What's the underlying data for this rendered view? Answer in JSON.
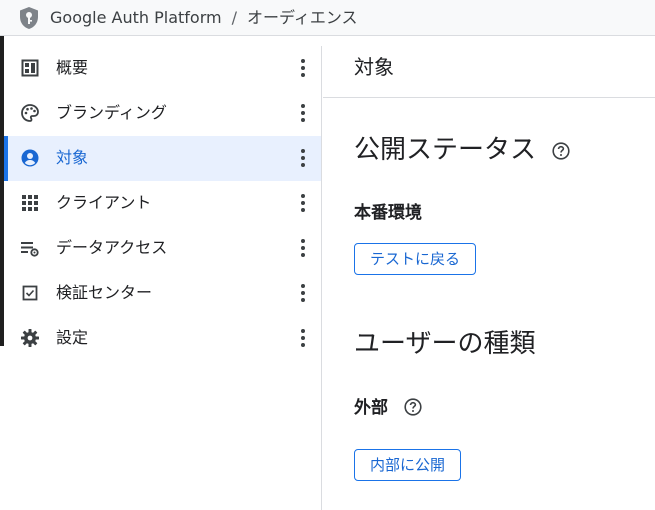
{
  "header": {
    "app_title": "Google Auth Platform",
    "separator": "/",
    "current_page": "オーディエンス"
  },
  "sidebar": {
    "items": [
      {
        "label": "概要",
        "icon": "dashboard-icon",
        "active": false
      },
      {
        "label": "ブランディング",
        "icon": "palette-icon",
        "active": false
      },
      {
        "label": "対象",
        "icon": "account-circle-icon",
        "active": true
      },
      {
        "label": "クライアント",
        "icon": "apps-grid-icon",
        "active": false
      },
      {
        "label": "データアクセス",
        "icon": "data-settings-icon",
        "active": false
      },
      {
        "label": "検証センター",
        "icon": "checkbox-icon",
        "active": false
      },
      {
        "label": "設定",
        "icon": "gear-icon",
        "active": false
      }
    ]
  },
  "main": {
    "page_title": "対象",
    "publish_status": {
      "title": "公開ステータス",
      "status": "本番環境",
      "button_label": "テストに戻る"
    },
    "user_type": {
      "title": "ユーザーの種類",
      "type": "外部",
      "button_label": "内部に公開"
    }
  },
  "colors": {
    "accent": "#1a73e8",
    "active_bg": "#e8f0fe",
    "active_text": "#1967d2",
    "divider": "#dadce0"
  }
}
